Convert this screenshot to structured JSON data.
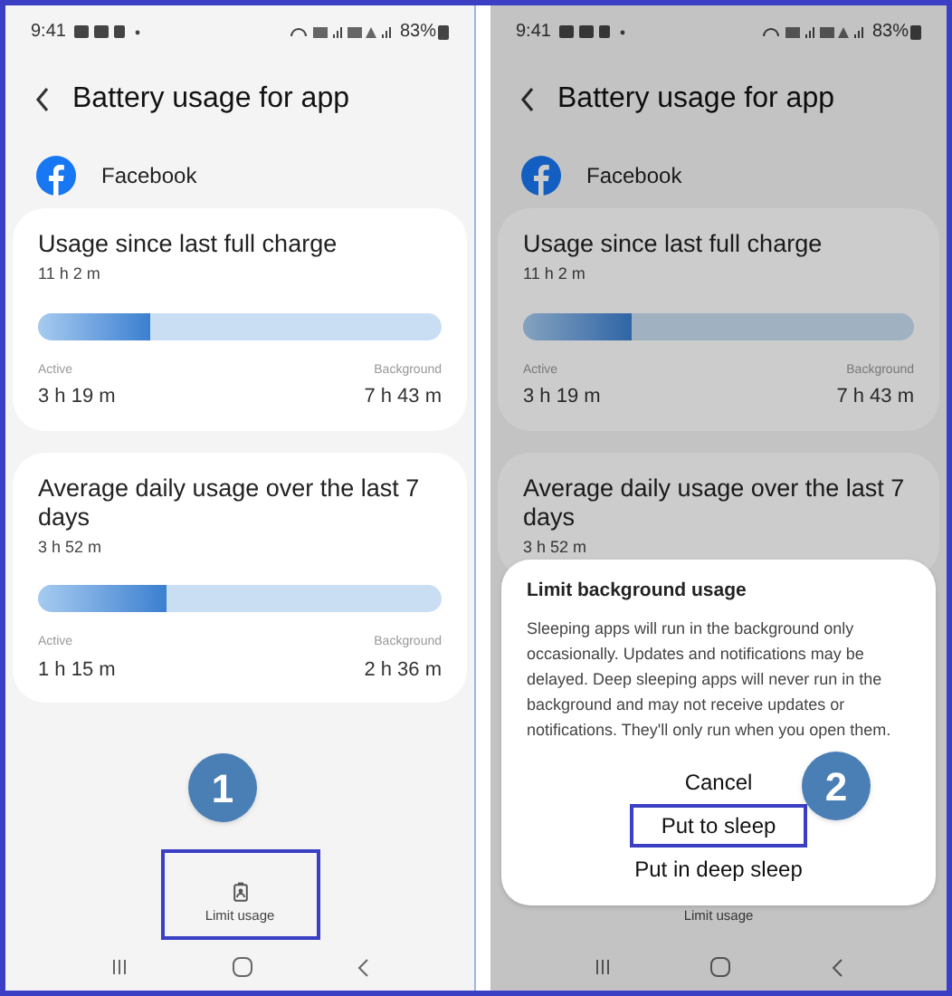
{
  "screens": [
    {
      "dimmed": false,
      "status_bar": {
        "time": "9:41",
        "battery": "83%"
      },
      "header": {
        "title": "Battery usage for app"
      },
      "app": {
        "name": "Facebook"
      },
      "cards": [
        {
          "title": "Usage since last full charge",
          "total": "11 h 2 m",
          "level": 0.28,
          "active_label": "Active",
          "active": "3 h 19 m",
          "background_label": "Background",
          "background": "7 h 43 m"
        },
        {
          "title": "Average daily usage over the last 7 days",
          "total": "3 h 52 m",
          "level": 0.32,
          "active_label": "Active",
          "active": "1 h 15 m",
          "background_label": "Background",
          "background": "2 h 36 m"
        }
      ],
      "bottom_action": {
        "label": "Limit usage",
        "highlighted": true
      },
      "step": "1"
    },
    {
      "dimmed": true,
      "status_bar": {
        "time": "9:41",
        "battery": "83%"
      },
      "header": {
        "title": "Battery usage for app"
      },
      "app": {
        "name": "Facebook"
      },
      "cards": [
        {
          "title": "Usage since last full charge",
          "total": "11 h 2 m",
          "level": 0.28,
          "active_label": "Active",
          "active": "3 h 19 m",
          "background_label": "Background",
          "background": "7 h 43 m"
        },
        {
          "title": "Average daily usage over the last 7 days",
          "total": "3 h 52 m"
        }
      ],
      "bottom_action": {
        "label": "Limit usage",
        "highlighted": false
      },
      "dialog": {
        "title": "Limit background usage",
        "body": "Sleeping apps will run in the background only occasionally. Updates and notifications may be delayed. Deep sleeping apps will never run in the background and may not receive updates or notifications. They'll only run when you open them.",
        "buttons": [
          {
            "label": "Cancel",
            "highlighted": false
          },
          {
            "label": "Put to sleep",
            "highlighted": true
          },
          {
            "label": "Put in deep sleep",
            "highlighted": false
          }
        ]
      },
      "step": "2"
    }
  ]
}
